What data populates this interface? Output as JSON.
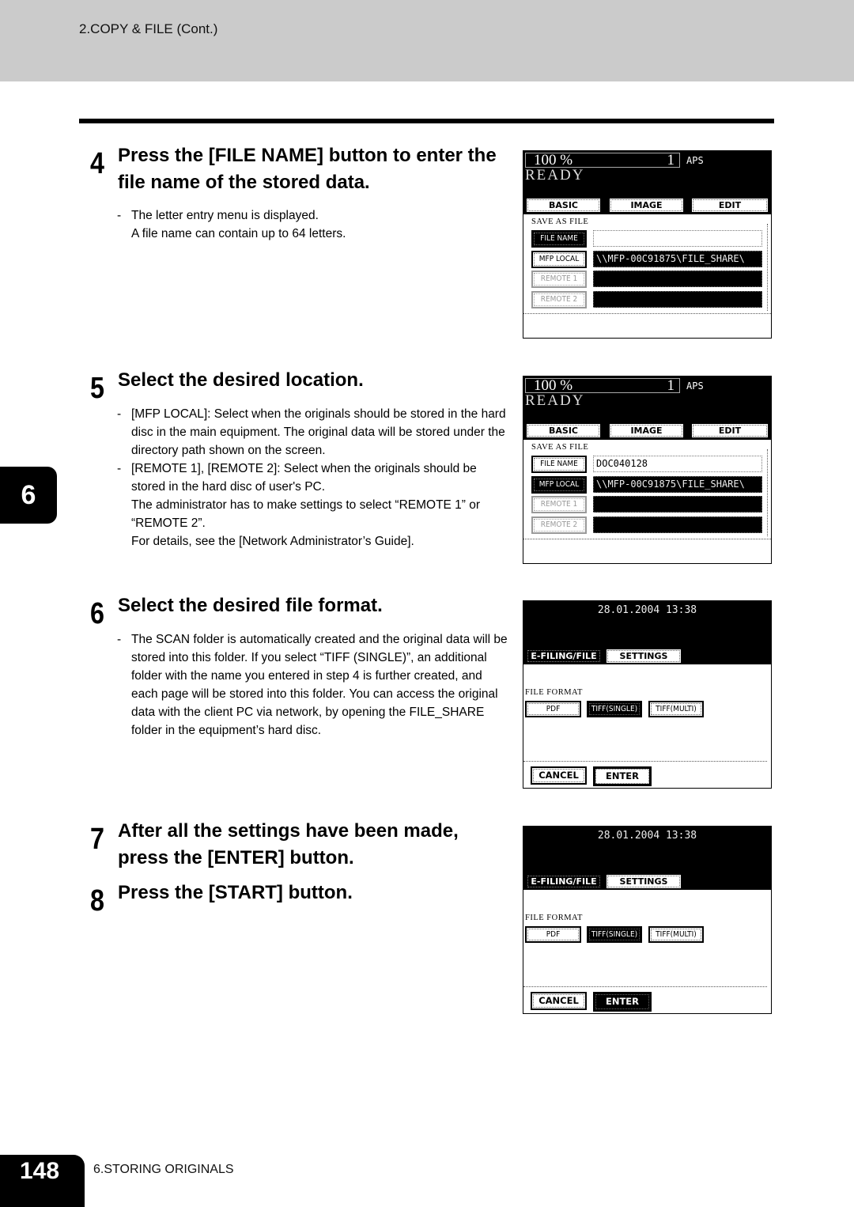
{
  "header": {
    "section": "2.COPY & FILE (Cont.)"
  },
  "chapter_tab": "6",
  "footer": {
    "page": "148",
    "chapter": "6.STORING ORIGINALS"
  },
  "steps": [
    {
      "num": "4",
      "title": "Press the [FILE NAME] button to enter the file name of the stored data.",
      "bullets": [
        {
          "lines": [
            "The letter entry menu is displayed.",
            "A file name can contain up to 64 letters."
          ]
        }
      ]
    },
    {
      "num": "5",
      "title": "Select the desired location.",
      "bullets": [
        {
          "lines": [
            "[MFP LOCAL]: Select when the originals should be stored in the hard disc in the main equipment. The original data will be stored under the directory path shown on the screen."
          ]
        },
        {
          "lines": [
            "[REMOTE 1], [REMOTE 2]: Select when the originals should be stored in the hard disc of user's PC.",
            "The administrator has to make settings to select “REMOTE 1” or “REMOTE 2”.",
            "For details, see the [Network Administrator’s Guide]."
          ]
        }
      ]
    },
    {
      "num": "6",
      "title": "Select the desired file format.",
      "bullets": [
        {
          "lines": [
            "The SCAN folder is automatically created and the original data will be stored into this folder. If you select “TIFF (SINGLE)”, an additional folder with the name you entered in step 4 is further created, and each page will be stored into this folder. You can access the original data with the client PC via network, by opening the FILE_SHARE folder in the equipment’s hard disc."
          ]
        }
      ]
    },
    {
      "num": "7",
      "title": "After all the settings have been made, press the [ENTER] button.",
      "bullets": []
    },
    {
      "num": "8",
      "title": "Press the [START] button.",
      "bullets": []
    }
  ],
  "screens": {
    "copy_a": {
      "zoom": "100  %",
      "count": "1",
      "paper": "APS",
      "status": "READY",
      "tabs": [
        "BASIC",
        "IMAGE",
        "EDIT"
      ],
      "section": "SAVE AS FILE",
      "rows": [
        {
          "label": "FILE NAME",
          "value": "",
          "state": "selected"
        },
        {
          "label": "MFP LOCAL",
          "value": "\\\\MFP-00C91875\\FILE_SHARE\\",
          "state": "normal"
        },
        {
          "label": "REMOTE 1",
          "value": "",
          "state": "disabled"
        },
        {
          "label": "REMOTE 2",
          "value": "",
          "state": "disabled"
        }
      ]
    },
    "copy_b": {
      "zoom": "100  %",
      "count": "1",
      "paper": "APS",
      "status": "READY",
      "tabs": [
        "BASIC",
        "IMAGE",
        "EDIT"
      ],
      "section": "SAVE AS FILE",
      "rows": [
        {
          "label": "FILE NAME",
          "value": "DOC040128",
          "state": "normal"
        },
        {
          "label": "MFP LOCAL",
          "value": "\\\\MFP-00C91875\\FILE_SHARE\\",
          "state": "selected"
        },
        {
          "label": "REMOTE 1",
          "value": "",
          "state": "disabled"
        },
        {
          "label": "REMOTE 2",
          "value": "",
          "state": "disabled"
        }
      ]
    },
    "format_a": {
      "datetime": "28.01.2004 13:38",
      "tabs": [
        "E-FILING/FILE",
        "SETTINGS"
      ],
      "label": "FILE FORMAT",
      "formats": [
        "PDF",
        "TIFF(SINGLE)",
        "TIFF(MULTI)"
      ],
      "selected_format": "TIFF(SINGLE)",
      "cancel": "CANCEL",
      "enter": "ENTER",
      "enter_pressed": false
    },
    "format_b": {
      "datetime": "28.01.2004 13:38",
      "tabs": [
        "E-FILING/FILE",
        "SETTINGS"
      ],
      "label": "FILE FORMAT",
      "formats": [
        "PDF",
        "TIFF(SINGLE)",
        "TIFF(MULTI)"
      ],
      "selected_format": "TIFF(SINGLE)",
      "cancel": "CANCEL",
      "enter": "ENTER",
      "enter_pressed": true
    }
  }
}
